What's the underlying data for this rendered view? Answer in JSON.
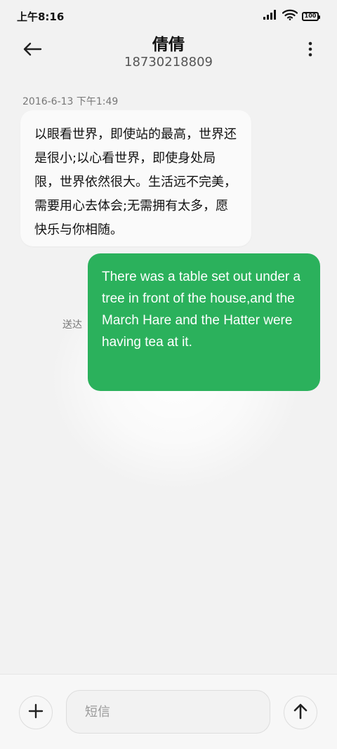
{
  "status_bar": {
    "time": "上午8:16",
    "battery": "100",
    "icons": [
      "signal-icon",
      "wifi-icon",
      "battery-icon"
    ]
  },
  "header": {
    "contact_name": "倩倩",
    "phone_number": "18730218809",
    "icons": [
      "back-arrow-icon",
      "more-vertical-icon"
    ]
  },
  "conversation": {
    "messages": [
      {
        "direction": "incoming",
        "timestamp": "2016-6-13 下午1:49",
        "text": "以眼看世界，即使站的最高，世界还是很小;以心看世界，即使身处局限，世界依然很大。生活远不完美，需要用心去体会;无需拥有太多，愿快乐与你相随。"
      },
      {
        "direction": "outgoing",
        "text": "There was a table set out under a tree in front of the house,and the March Hare and the Hatter were having tea at it.",
        "status": "送达"
      }
    ]
  },
  "composer": {
    "placeholder": "短信",
    "value": "",
    "icons": [
      "plus-icon",
      "send-arrow-icon"
    ]
  },
  "colors": {
    "background": "#f2f2f2",
    "incoming_bubble": "#fafafa",
    "outgoing_bubble": "#2bb15c",
    "outgoing_text": "#ffffff"
  }
}
